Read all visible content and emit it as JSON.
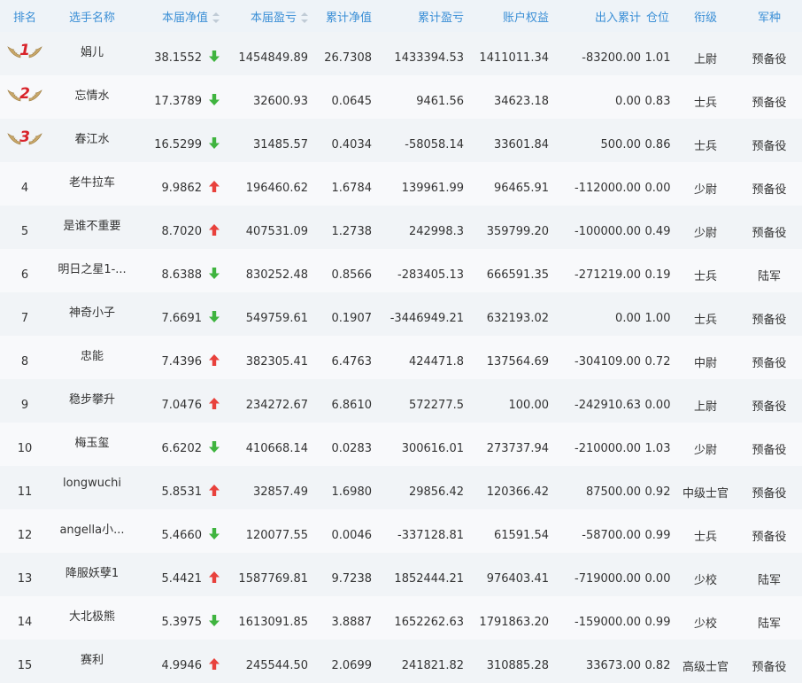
{
  "columns": {
    "rank": "排名",
    "name": "选手名称",
    "nav": "本届净值",
    "pnl": "本届盈亏",
    "cum_nav": "累计净值",
    "cum_pnl": "累计盈亏",
    "equity": "账户权益",
    "flow": "出入累计",
    "position": "仓位",
    "title": "衔级",
    "branch": "军种"
  },
  "colors": {
    "up": "#e8413c",
    "down": "#3fb43f",
    "header_text": "#3b8fd6",
    "rank_badge": "#d8232a"
  },
  "rows": [
    {
      "rank": "1",
      "name": "娟儿",
      "nav": "38.1552",
      "trend": "down",
      "pnl": "1454849.89",
      "cum_nav": "26.7308",
      "cum_pnl": "1433394.53",
      "equity": "1411011.34",
      "flow": "-83200.00",
      "position": "1.01",
      "title": "上尉",
      "branch": "预备役"
    },
    {
      "rank": "2",
      "name": "忘情水",
      "nav": "17.3789",
      "trend": "down",
      "pnl": "32600.93",
      "cum_nav": "0.0645",
      "cum_pnl": "9461.56",
      "equity": "34623.18",
      "flow": "0.00",
      "position": "0.83",
      "title": "士兵",
      "branch": "预备役"
    },
    {
      "rank": "3",
      "name": "春江水",
      "nav": "16.5299",
      "trend": "down",
      "pnl": "31485.57",
      "cum_nav": "0.4034",
      "cum_pnl": "-58058.14",
      "equity": "33601.84",
      "flow": "500.00",
      "position": "0.86",
      "title": "士兵",
      "branch": "预备役"
    },
    {
      "rank": "4",
      "name": "老牛拉车",
      "nav": "9.9862",
      "trend": "up",
      "pnl": "196460.62",
      "cum_nav": "1.6784",
      "cum_pnl": "139961.99",
      "equity": "96465.91",
      "flow": "-112000.00",
      "position": "0.00",
      "title": "少尉",
      "branch": "预备役"
    },
    {
      "rank": "5",
      "name": "是谁不重要",
      "nav": "8.7020",
      "trend": "up",
      "pnl": "407531.09",
      "cum_nav": "1.2738",
      "cum_pnl": "242998.3",
      "equity": "359799.20",
      "flow": "-100000.00",
      "position": "0.49",
      "title": "少尉",
      "branch": "预备役"
    },
    {
      "rank": "6",
      "name": "明日之星1-...",
      "nav": "8.6388",
      "trend": "down",
      "pnl": "830252.48",
      "cum_nav": "0.8566",
      "cum_pnl": "-283405.13",
      "equity": "666591.35",
      "flow": "-271219.00",
      "position": "0.19",
      "title": "士兵",
      "branch": "陆军"
    },
    {
      "rank": "7",
      "name": "神奇小子",
      "nav": "7.6691",
      "trend": "down",
      "pnl": "549759.61",
      "cum_nav": "0.1907",
      "cum_pnl": "-3446949.21",
      "equity": "632193.02",
      "flow": "0.00",
      "position": "1.00",
      "title": "士兵",
      "branch": "预备役"
    },
    {
      "rank": "8",
      "name": "忠能",
      "nav": "7.4396",
      "trend": "up",
      "pnl": "382305.41",
      "cum_nav": "6.4763",
      "cum_pnl": "424471.8",
      "equity": "137564.69",
      "flow": "-304109.00",
      "position": "0.72",
      "title": "中尉",
      "branch": "预备役"
    },
    {
      "rank": "9",
      "name": "稳步攀升",
      "nav": "7.0476",
      "trend": "up",
      "pnl": "234272.67",
      "cum_nav": "6.8610",
      "cum_pnl": "572277.5",
      "equity": "100.00",
      "flow": "-242910.63",
      "position": "0.00",
      "title": "上尉",
      "branch": "预备役"
    },
    {
      "rank": "10",
      "name": "梅玉玺",
      "nav": "6.6202",
      "trend": "down",
      "pnl": "410668.14",
      "cum_nav": "0.0283",
      "cum_pnl": "300616.01",
      "equity": "273737.94",
      "flow": "-210000.00",
      "position": "1.03",
      "title": "少尉",
      "branch": "预备役"
    },
    {
      "rank": "11",
      "name": "longwuchi",
      "nav": "5.8531",
      "trend": "up",
      "pnl": "32857.49",
      "cum_nav": "1.6980",
      "cum_pnl": "29856.42",
      "equity": "120366.42",
      "flow": "87500.00",
      "position": "0.92",
      "title": "中级士官",
      "branch": "预备役"
    },
    {
      "rank": "12",
      "name": "angella小...",
      "nav": "5.4660",
      "trend": "down",
      "pnl": "120077.55",
      "cum_nav": "0.0046",
      "cum_pnl": "-337128.81",
      "equity": "61591.54",
      "flow": "-58700.00",
      "position": "0.99",
      "title": "士兵",
      "branch": "预备役"
    },
    {
      "rank": "13",
      "name": "降服妖孽1",
      "nav": "5.4421",
      "trend": "up",
      "pnl": "1587769.81",
      "cum_nav": "9.7238",
      "cum_pnl": "1852444.21",
      "equity": "976403.41",
      "flow": "-719000.00",
      "position": "0.00",
      "title": "少校",
      "branch": "陆军"
    },
    {
      "rank": "14",
      "name": "大北极熊",
      "nav": "5.3975",
      "trend": "down",
      "pnl": "1613091.85",
      "cum_nav": "3.8887",
      "cum_pnl": "1652262.63",
      "equity": "1791863.20",
      "flow": "-159000.00",
      "position": "0.99",
      "title": "少校",
      "branch": "陆军"
    },
    {
      "rank": "15",
      "name": "赛利",
      "nav": "4.9946",
      "trend": "up",
      "pnl": "245544.50",
      "cum_nav": "2.0699",
      "cum_pnl": "241821.82",
      "equity": "310885.28",
      "flow": "33673.00",
      "position": "0.82",
      "title": "高级士官",
      "branch": "预备役"
    }
  ]
}
